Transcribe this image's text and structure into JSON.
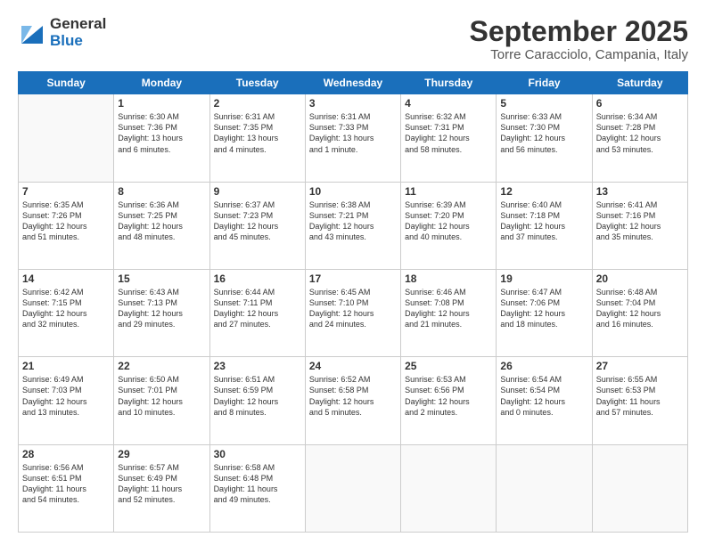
{
  "header": {
    "logo_general": "General",
    "logo_blue": "Blue",
    "month_title": "September 2025",
    "location": "Torre Caracciolo, Campania, Italy"
  },
  "days_of_week": [
    "Sunday",
    "Monday",
    "Tuesday",
    "Wednesday",
    "Thursday",
    "Friday",
    "Saturday"
  ],
  "weeks": [
    [
      {
        "day": "",
        "info": ""
      },
      {
        "day": "1",
        "info": "Sunrise: 6:30 AM\nSunset: 7:36 PM\nDaylight: 13 hours\nand 6 minutes."
      },
      {
        "day": "2",
        "info": "Sunrise: 6:31 AM\nSunset: 7:35 PM\nDaylight: 13 hours\nand 4 minutes."
      },
      {
        "day": "3",
        "info": "Sunrise: 6:31 AM\nSunset: 7:33 PM\nDaylight: 13 hours\nand 1 minute."
      },
      {
        "day": "4",
        "info": "Sunrise: 6:32 AM\nSunset: 7:31 PM\nDaylight: 12 hours\nand 58 minutes."
      },
      {
        "day": "5",
        "info": "Sunrise: 6:33 AM\nSunset: 7:30 PM\nDaylight: 12 hours\nand 56 minutes."
      },
      {
        "day": "6",
        "info": "Sunrise: 6:34 AM\nSunset: 7:28 PM\nDaylight: 12 hours\nand 53 minutes."
      }
    ],
    [
      {
        "day": "7",
        "info": "Sunrise: 6:35 AM\nSunset: 7:26 PM\nDaylight: 12 hours\nand 51 minutes."
      },
      {
        "day": "8",
        "info": "Sunrise: 6:36 AM\nSunset: 7:25 PM\nDaylight: 12 hours\nand 48 minutes."
      },
      {
        "day": "9",
        "info": "Sunrise: 6:37 AM\nSunset: 7:23 PM\nDaylight: 12 hours\nand 45 minutes."
      },
      {
        "day": "10",
        "info": "Sunrise: 6:38 AM\nSunset: 7:21 PM\nDaylight: 12 hours\nand 43 minutes."
      },
      {
        "day": "11",
        "info": "Sunrise: 6:39 AM\nSunset: 7:20 PM\nDaylight: 12 hours\nand 40 minutes."
      },
      {
        "day": "12",
        "info": "Sunrise: 6:40 AM\nSunset: 7:18 PM\nDaylight: 12 hours\nand 37 minutes."
      },
      {
        "day": "13",
        "info": "Sunrise: 6:41 AM\nSunset: 7:16 PM\nDaylight: 12 hours\nand 35 minutes."
      }
    ],
    [
      {
        "day": "14",
        "info": "Sunrise: 6:42 AM\nSunset: 7:15 PM\nDaylight: 12 hours\nand 32 minutes."
      },
      {
        "day": "15",
        "info": "Sunrise: 6:43 AM\nSunset: 7:13 PM\nDaylight: 12 hours\nand 29 minutes."
      },
      {
        "day": "16",
        "info": "Sunrise: 6:44 AM\nSunset: 7:11 PM\nDaylight: 12 hours\nand 27 minutes."
      },
      {
        "day": "17",
        "info": "Sunrise: 6:45 AM\nSunset: 7:10 PM\nDaylight: 12 hours\nand 24 minutes."
      },
      {
        "day": "18",
        "info": "Sunrise: 6:46 AM\nSunset: 7:08 PM\nDaylight: 12 hours\nand 21 minutes."
      },
      {
        "day": "19",
        "info": "Sunrise: 6:47 AM\nSunset: 7:06 PM\nDaylight: 12 hours\nand 18 minutes."
      },
      {
        "day": "20",
        "info": "Sunrise: 6:48 AM\nSunset: 7:04 PM\nDaylight: 12 hours\nand 16 minutes."
      }
    ],
    [
      {
        "day": "21",
        "info": "Sunrise: 6:49 AM\nSunset: 7:03 PM\nDaylight: 12 hours\nand 13 minutes."
      },
      {
        "day": "22",
        "info": "Sunrise: 6:50 AM\nSunset: 7:01 PM\nDaylight: 12 hours\nand 10 minutes."
      },
      {
        "day": "23",
        "info": "Sunrise: 6:51 AM\nSunset: 6:59 PM\nDaylight: 12 hours\nand 8 minutes."
      },
      {
        "day": "24",
        "info": "Sunrise: 6:52 AM\nSunset: 6:58 PM\nDaylight: 12 hours\nand 5 minutes."
      },
      {
        "day": "25",
        "info": "Sunrise: 6:53 AM\nSunset: 6:56 PM\nDaylight: 12 hours\nand 2 minutes."
      },
      {
        "day": "26",
        "info": "Sunrise: 6:54 AM\nSunset: 6:54 PM\nDaylight: 12 hours\nand 0 minutes."
      },
      {
        "day": "27",
        "info": "Sunrise: 6:55 AM\nSunset: 6:53 PM\nDaylight: 11 hours\nand 57 minutes."
      }
    ],
    [
      {
        "day": "28",
        "info": "Sunrise: 6:56 AM\nSunset: 6:51 PM\nDaylight: 11 hours\nand 54 minutes."
      },
      {
        "day": "29",
        "info": "Sunrise: 6:57 AM\nSunset: 6:49 PM\nDaylight: 11 hours\nand 52 minutes."
      },
      {
        "day": "30",
        "info": "Sunrise: 6:58 AM\nSunset: 6:48 PM\nDaylight: 11 hours\nand 49 minutes."
      },
      {
        "day": "",
        "info": ""
      },
      {
        "day": "",
        "info": ""
      },
      {
        "day": "",
        "info": ""
      },
      {
        "day": "",
        "info": ""
      }
    ]
  ]
}
